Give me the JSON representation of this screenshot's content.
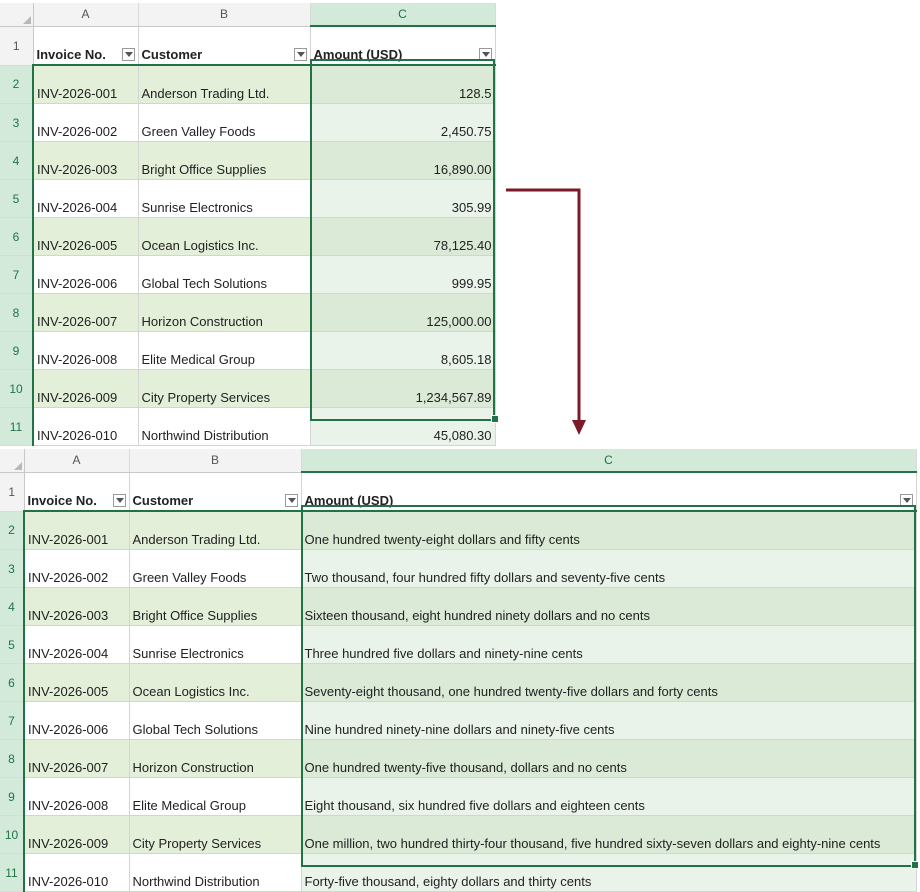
{
  "columns": [
    "A",
    "B",
    "C"
  ],
  "headers": {
    "invoice": "Invoice No.",
    "customer": "Customer",
    "amount": "Amount (USD)"
  },
  "rows": [
    {
      "num": "1"
    },
    {
      "num": "2",
      "invoice": "INV-2026-001",
      "customer": "Anderson Trading Ltd.",
      "amount": "128.5",
      "words": "One hundred twenty-eight dollars and fifty cents"
    },
    {
      "num": "3",
      "invoice": "INV-2026-002",
      "customer": "Green Valley Foods",
      "amount": "2,450.75",
      "words": "Two thousand, four hundred fifty dollars and seventy-five cents"
    },
    {
      "num": "4",
      "invoice": "INV-2026-003",
      "customer": "Bright Office Supplies",
      "amount": "16,890.00",
      "words": "Sixteen thousand, eight hundred ninety dollars and no cents"
    },
    {
      "num": "5",
      "invoice": "INV-2026-004",
      "customer": "Sunrise Electronics",
      "amount": "305.99",
      "words": "Three hundred five dollars and ninety-nine cents"
    },
    {
      "num": "6",
      "invoice": "INV-2026-005",
      "customer": "Ocean Logistics Inc.",
      "amount": "78,125.40",
      "words": "Seventy-eight thousand, one hundred twenty-five dollars and forty cents"
    },
    {
      "num": "7",
      "invoice": "INV-2026-006",
      "customer": "Global Tech Solutions",
      "amount": "999.95",
      "words": "Nine hundred ninety-nine dollars and ninety-five cents"
    },
    {
      "num": "8",
      "invoice": "INV-2026-007",
      "customer": "Horizon Construction",
      "amount": "125,000.00",
      "words": "One hundred twenty-five thousand, dollars and no cents"
    },
    {
      "num": "9",
      "invoice": "INV-2026-008",
      "customer": "Elite Medical Group",
      "amount": "8,605.18",
      "words": "Eight thousand, six hundred five dollars and eighteen cents"
    },
    {
      "num": "10",
      "invoice": "INV-2026-009",
      "customer": "City Property Services",
      "amount": "1,234,567.89",
      "words": "One million, two hundred thirty-four thousand, five hundred sixty-seven dollars and eighty-nine cents"
    },
    {
      "num": "11",
      "invoice": "INV-2026-010",
      "customer": "Northwind Distribution",
      "amount": "45,080.30",
      "words": "Forty-five thousand, eighty dollars and thirty cents"
    }
  ],
  "colors": {
    "accent": "#217346",
    "arrow": "#7b1a28",
    "band": "#e3efd9"
  }
}
